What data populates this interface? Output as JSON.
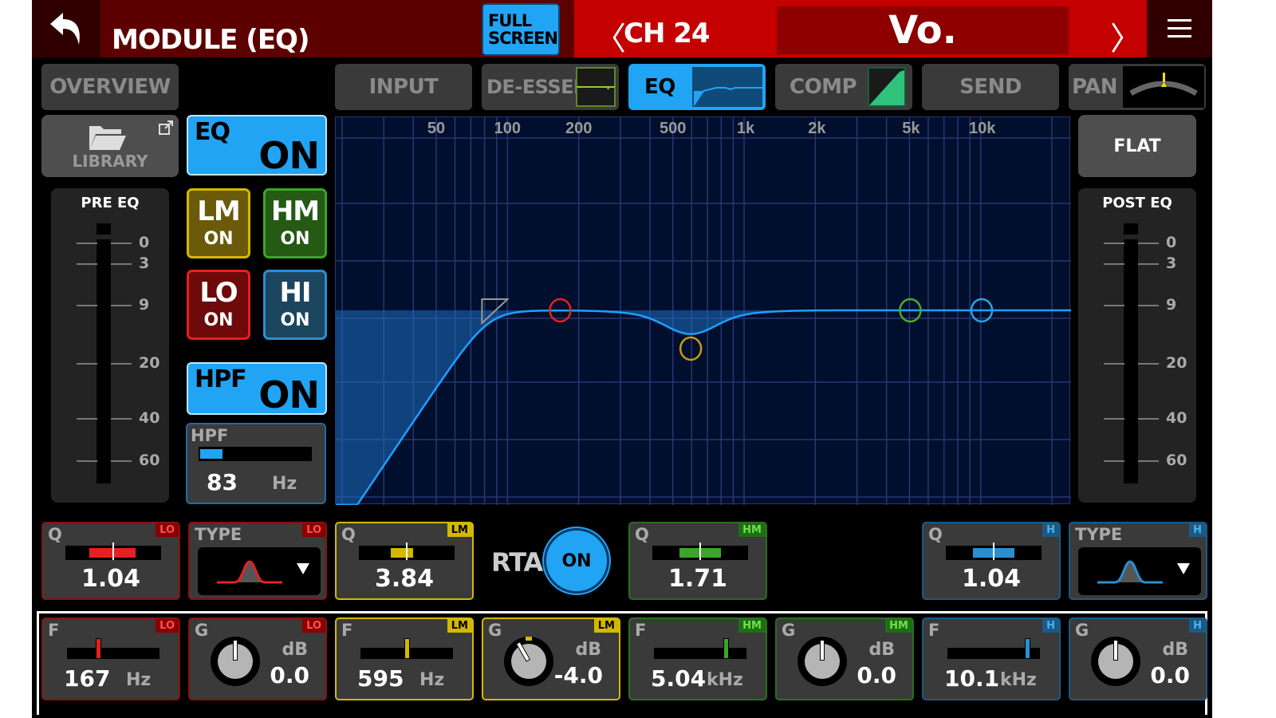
{
  "header": {
    "title": "MODULE (EQ)",
    "fullscreen_label_line1": "FULL",
    "fullscreen_label_line2": "SCREEN",
    "channel_label": "CH 24",
    "channel_name": "Vo.",
    "prev_glyph": "〈",
    "next_glyph": "〉"
  },
  "tabs": [
    {
      "label": "OVERVIEW",
      "active": false
    },
    {
      "label": "INPUT",
      "active": false
    },
    {
      "label": "DE-ESSER",
      "active": false
    },
    {
      "label": "EQ",
      "active": true
    },
    {
      "label": "COMP",
      "active": false
    },
    {
      "label": "SEND",
      "active": false
    },
    {
      "label": "PAN",
      "active": false
    }
  ],
  "library": {
    "label": "LIBRARY"
  },
  "flat": {
    "label": "FLAT"
  },
  "pre_meter": {
    "title": "PRE EQ",
    "scale": [
      "0",
      "3",
      "9",
      "20",
      "40",
      "60"
    ]
  },
  "post_meter": {
    "title": "POST EQ",
    "scale": [
      "0",
      "3",
      "9",
      "20",
      "40",
      "60"
    ]
  },
  "eq_switch": {
    "label": "EQ",
    "state": "ON"
  },
  "hpf_switch": {
    "label": "HPF",
    "state": "ON"
  },
  "bands": [
    {
      "id": "lm",
      "label": "LM",
      "state": "ON",
      "color": "#d4b800"
    },
    {
      "id": "hm",
      "label": "HM",
      "state": "ON",
      "color": "#3aa52a"
    },
    {
      "id": "lo",
      "label": "LO",
      "state": "ON",
      "color": "#e52020"
    },
    {
      "id": "hi",
      "label": "HI",
      "state": "ON",
      "color": "#2a8fd0"
    }
  ],
  "hpf": {
    "label": "HPF",
    "value": "83",
    "unit": "Hz",
    "level_fraction": 0.2
  },
  "graph": {
    "freq_labels": [
      "50",
      "100",
      "200",
      "500",
      "1k",
      "2k",
      "5k",
      "10k"
    ],
    "curve_color": "#1ea0ff"
  },
  "rta": {
    "label": "RTA",
    "state": "ON"
  },
  "q_boxes": [
    {
      "band": "LO",
      "label": "Q",
      "value": "1.04",
      "color": "#e52020",
      "tag_bg": "#8a0000",
      "tag_color": "#ff5050"
    },
    {
      "band": "LM",
      "label": "Q",
      "value": "3.84",
      "color": "#d4b800",
      "tag_bg": "#d4b800",
      "tag_color": "#000"
    },
    {
      "band": "HM",
      "label": "Q",
      "value": "1.71",
      "color": "#3aa52a",
      "tag_bg": "#1e6e14",
      "tag_color": "#6ee04a"
    },
    {
      "band": "H",
      "label": "Q",
      "value": "1.04",
      "color": "#2a8fd0",
      "tag_bg": "#1b5a85",
      "tag_color": "#4ab0f0"
    }
  ],
  "type_boxes": [
    {
      "band": "LO",
      "label": "TYPE",
      "value": "bell"
    },
    {
      "band": "H",
      "label": "TYPE",
      "value": "bell"
    }
  ],
  "freq_boxes": [
    {
      "band": "LO",
      "label": "F",
      "value": "167",
      "unit": "Hz",
      "position_fraction": 0.34
    },
    {
      "band": "LM",
      "label": "F",
      "value": "595",
      "unit": "Hz",
      "position_fraction": 0.5
    },
    {
      "band": "HM",
      "label": "F",
      "value": "5.04",
      "unit": "kHz",
      "position_fraction": 0.78
    },
    {
      "band": "H",
      "label": "F",
      "value": "10.1",
      "unit": "kHz",
      "position_fraction": 0.86
    }
  ],
  "gain_boxes": [
    {
      "band": "LO",
      "label": "G",
      "value": "0.0",
      "unit": "dB",
      "gain_db": 0
    },
    {
      "band": "LM",
      "label": "G",
      "value": "-4.0",
      "unit": "dB",
      "gain_db": -4
    },
    {
      "band": "HM",
      "label": "G",
      "value": "0.0",
      "unit": "dB",
      "gain_db": 0
    },
    {
      "band": "H",
      "label": "G",
      "value": "0.0",
      "unit": "dB",
      "gain_db": 0
    }
  ]
}
